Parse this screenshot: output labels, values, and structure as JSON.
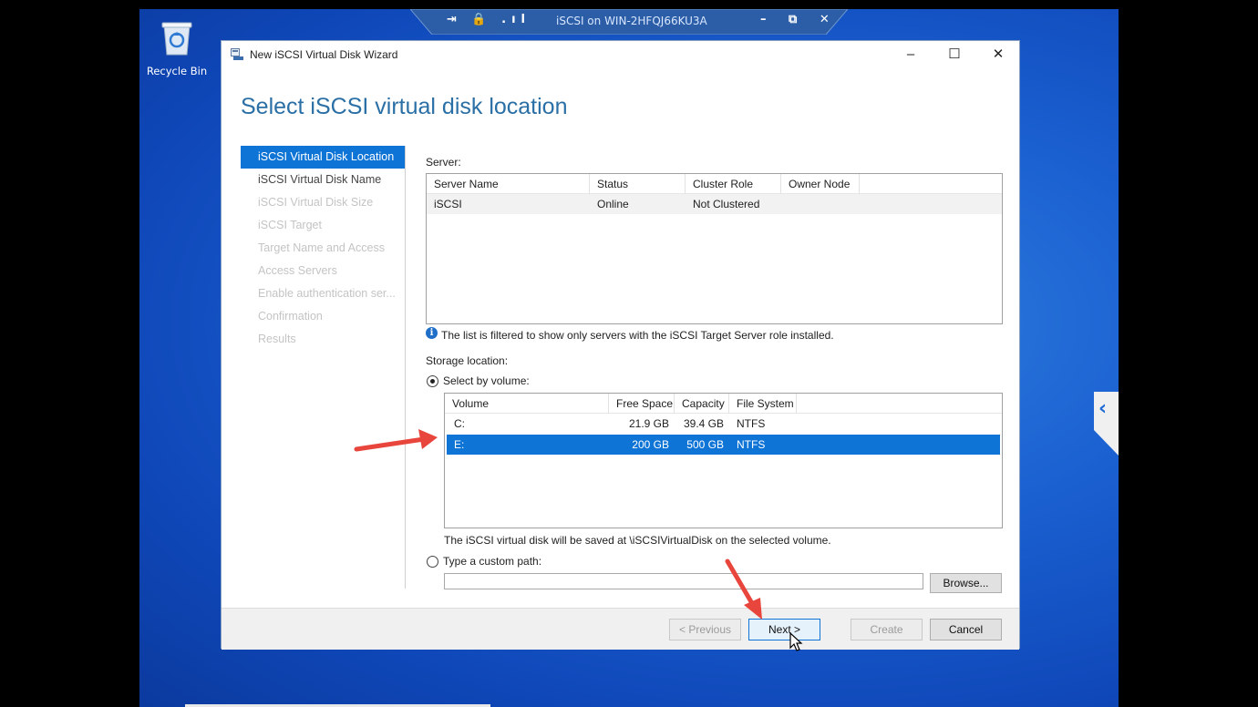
{
  "desktop": {
    "recycle_bin_label": "Recycle Bin",
    "remote_bar_title": "iSCSI on WIN-2HFQJ66KU3A",
    "remote_bar_left_icons": "⇥ 🔒 .ıl",
    "remote_bar_right_icons": "– ⧉ ✕"
  },
  "window": {
    "title": "New iSCSI Virtual Disk Wizard",
    "minimize": "–",
    "maximize": "☐",
    "close": "✕"
  },
  "page_title": "Select iSCSI virtual disk location",
  "nav": {
    "items": [
      {
        "label": "iSCSI Virtual Disk Location",
        "state": "active"
      },
      {
        "label": "iSCSI Virtual Disk Name",
        "state": "enabled"
      },
      {
        "label": "iSCSI Virtual Disk Size",
        "state": "disabled"
      },
      {
        "label": "iSCSI Target",
        "state": "disabled"
      },
      {
        "label": "Target Name and Access",
        "state": "disabled"
      },
      {
        "label": "Access Servers",
        "state": "disabled"
      },
      {
        "label": "Enable authentication ser...",
        "state": "disabled"
      },
      {
        "label": "Confirmation",
        "state": "disabled"
      },
      {
        "label": "Results",
        "state": "disabled"
      }
    ]
  },
  "server": {
    "label": "Server:",
    "columns": [
      "Server Name",
      "Status",
      "Cluster Role",
      "Owner Node"
    ],
    "rows": [
      [
        "iSCSI",
        "Online",
        "Not Clustered",
        ""
      ]
    ],
    "info_text": "The list is filtered to show only servers with the iSCSI Target Server role installed."
  },
  "storage": {
    "label": "Storage location:",
    "by_volume_label": "Select by volume:",
    "columns": [
      "Volume",
      "Free Space",
      "Capacity",
      "File System"
    ],
    "rows": [
      [
        "C:",
        "21.9 GB",
        "39.4 GB",
        "NTFS"
      ],
      [
        "E:",
        "200 GB",
        "500 GB",
        "NTFS"
      ]
    ],
    "selected_row": 1,
    "save_note": "The iSCSI virtual disk will be saved at \\iSCSIVirtualDisk on the selected volume.",
    "custom_path_label": "Type a custom path:",
    "custom_path_value": "",
    "browse_label": "Browse..."
  },
  "footer": {
    "previous_label": "< Previous",
    "next_label": "Next >",
    "create_label": "Create",
    "cancel_label": "Cancel"
  },
  "colors": {
    "accent": "#0e74d6",
    "annotation_arrow": "#e8453c",
    "heading": "#2a6fa5"
  }
}
